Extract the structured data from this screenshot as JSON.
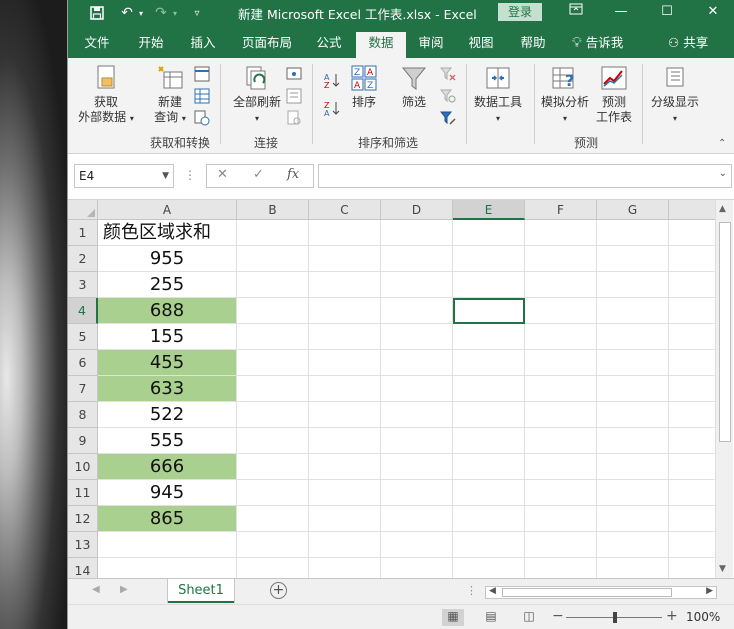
{
  "window": {
    "title": "新建 Microsoft Excel 工作表.xlsx  -  Excel",
    "login_label": "登录"
  },
  "tabs": [
    {
      "label": "文件",
      "active": false
    },
    {
      "label": "开始",
      "active": false
    },
    {
      "label": "插入",
      "active": false
    },
    {
      "label": "页面布局",
      "active": false
    },
    {
      "label": "公式",
      "active": false
    },
    {
      "label": "数据",
      "active": true
    },
    {
      "label": "审阅",
      "active": false
    },
    {
      "label": "视图",
      "active": false
    },
    {
      "label": "帮助",
      "active": false
    }
  ],
  "tell_me": "告诉我",
  "share": "共享",
  "ribbon": {
    "get_external_1": "获取",
    "get_external_2": "外部数据",
    "new_query_1": "新建",
    "new_query_2": "查询",
    "group_get_transform": "获取和转换",
    "refresh_all": "全部刷新",
    "group_connections": "连接",
    "sort": "排序",
    "filter": "筛选",
    "group_sort_filter": "排序和筛选",
    "data_tools": "数据工具",
    "what_if": "模拟分析",
    "forecast_1": "预测",
    "forecast_2": "工作表",
    "group_forecast": "预测",
    "outline": "分级显示"
  },
  "formula_bar": {
    "name_box": "E4",
    "formula": ""
  },
  "sheet": {
    "columns": [
      "A",
      "B",
      "C",
      "D",
      "E",
      "F",
      "G"
    ],
    "selected_column": "E",
    "selected_row": 4,
    "rows": [
      {
        "num": "1",
        "a": "颜色区域求和",
        "green": false
      },
      {
        "num": "2",
        "a": "955",
        "green": false
      },
      {
        "num": "3",
        "a": "255",
        "green": false
      },
      {
        "num": "4",
        "a": "688",
        "green": true
      },
      {
        "num": "5",
        "a": "155",
        "green": false
      },
      {
        "num": "6",
        "a": "455",
        "green": true
      },
      {
        "num": "7",
        "a": "633",
        "green": true
      },
      {
        "num": "8",
        "a": "522",
        "green": false
      },
      {
        "num": "9",
        "a": "555",
        "green": false
      },
      {
        "num": "10",
        "a": "666",
        "green": true
      },
      {
        "num": "11",
        "a": "945",
        "green": false
      },
      {
        "num": "12",
        "a": "865",
        "green": true
      },
      {
        "num": "13",
        "a": "",
        "green": false
      },
      {
        "num": "14",
        "a": "",
        "green": false
      }
    ],
    "highlight_color": "#a9d08e"
  },
  "sheet_tabs": [
    {
      "label": "Sheet1",
      "active": true
    }
  ],
  "status": {
    "zoom": "100%"
  },
  "colors": {
    "accent": "#217346"
  }
}
